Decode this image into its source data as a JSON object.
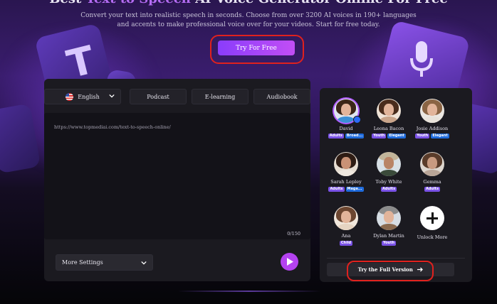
{
  "hero": {
    "title_pre": "Best ",
    "title_accent": "Text to Speech",
    "title_post": " AI Voice Generator Online For Free",
    "subtitle": "Convert your text into realistic speech in seconds. Choose from over 3200 AI voices in 190+ languages and accents to make professional voice over for your videos. Start for free today.",
    "cta_label": "Try For Free"
  },
  "toolbar": {
    "language": "English",
    "modes": [
      "Podcast",
      "E-learning",
      "Audiobook"
    ]
  },
  "editor": {
    "text": "https://www.topmediai.com/text-to-speech-online/",
    "counter": "0/150"
  },
  "controls": {
    "more_settings": "More Settings"
  },
  "voices": [
    {
      "name": "David",
      "tags": [
        "Adults",
        "Broad..."
      ],
      "selected": true
    },
    {
      "name": "Leona Bacon",
      "tags": [
        "Youth",
        "Elegant"
      ]
    },
    {
      "name": "Josie Addison",
      "tags": [
        "Youth",
        "Elegant"
      ]
    },
    {
      "name": "Sarah Lepley",
      "tags": [
        "Adults",
        "Maga..."
      ]
    },
    {
      "name": "Toby White",
      "tags": [
        "Adults"
      ]
    },
    {
      "name": "Gemma",
      "tags": [
        "Adults"
      ]
    },
    {
      "name": "Ana",
      "tags": [
        "Child"
      ]
    },
    {
      "name": "Dylan Martin",
      "tags": [
        "Youth"
      ]
    }
  ],
  "unlock_label": "Unlock More",
  "full_version_label": "Try the Full Version",
  "colors": {
    "accent": "#b442f0",
    "highlight": "#e0211e",
    "tag_purple": "#7a52e6",
    "tag_blue": "#1f6bdc",
    "panel": "#1b1a20"
  }
}
